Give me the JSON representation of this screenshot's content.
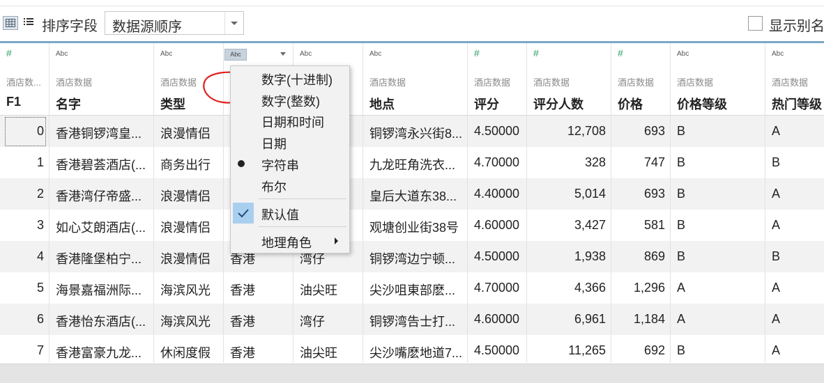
{
  "toolbar": {
    "sort_label": "排序字段",
    "sort_value": "数据源顺序",
    "show_alias_label": "显示别名"
  },
  "columns": [
    {
      "type": "#",
      "source": "酒店数...",
      "name": "F1"
    },
    {
      "type": "Abc",
      "source": "酒店数据",
      "name": "名字"
    },
    {
      "type": "Abc",
      "source": "酒店数据",
      "name": "类型"
    },
    {
      "type": "Abc",
      "source": "",
      "name": ""
    },
    {
      "type": "Abc",
      "source": "",
      "name": ""
    },
    {
      "type": "Abc",
      "source": "酒店数据",
      "name": "地点"
    },
    {
      "type": "#",
      "source": "酒店数据",
      "name": "评分"
    },
    {
      "type": "#",
      "source": "酒店数据",
      "name": "评分人数"
    },
    {
      "type": "#",
      "source": "酒店数据",
      "name": "价格"
    },
    {
      "type": "Abc",
      "source": "酒店数据",
      "name": "价格等级"
    },
    {
      "type": "Abc",
      "source": "酒店数据",
      "name": "热门等级"
    }
  ],
  "rows": [
    [
      "0",
      "香港铜锣湾皇...",
      "浪漫情侣",
      "",
      "",
      "铜锣湾永兴街8...",
      "4.50000",
      "12,708",
      "693",
      "B",
      "A"
    ],
    [
      "1",
      "香港碧荟酒店(...",
      "商务出行",
      "",
      "",
      "九龙旺角洗衣...",
      "4.70000",
      "328",
      "747",
      "B",
      "B"
    ],
    [
      "2",
      "香港湾仔帝盛...",
      "浪漫情侣",
      "",
      "",
      "皇后大道东38...",
      "4.40000",
      "5,014",
      "693",
      "B",
      "A"
    ],
    [
      "3",
      "如心艾朗酒店(...",
      "浪漫情侣",
      "",
      "",
      "观塘创业街38号",
      "4.60000",
      "3,427",
      "581",
      "B",
      "A"
    ],
    [
      "4",
      "香港隆堡柏宁...",
      "浪漫情侣",
      "香港",
      "湾仔",
      "铜锣湾边宁顿...",
      "4.50000",
      "1,938",
      "869",
      "B",
      "B"
    ],
    [
      "5",
      "海景嘉福洲际...",
      "海滨风光",
      "香港",
      "油尖旺",
      "尖沙咀東部麽...",
      "4.70000",
      "4,366",
      "1,296",
      "A",
      "A"
    ],
    [
      "6",
      "香港怡东酒店(...",
      "海滨风光",
      "香港",
      "湾仔",
      "铜锣湾告士打...",
      "4.60000",
      "6,961",
      "1,184",
      "A",
      "A"
    ],
    [
      "7",
      "香港富豪九龙...",
      "休闲度假",
      "香港",
      "油尖旺",
      "尖沙嘴麽地道7...",
      "4.50000",
      "11,265",
      "692",
      "B",
      "A"
    ]
  ],
  "context_menu": {
    "items": [
      {
        "label": "数字(十进制)",
        "mark": ""
      },
      {
        "label": "数字(整数)",
        "mark": ""
      },
      {
        "label": "日期和时间",
        "mark": ""
      },
      {
        "label": "日期",
        "mark": ""
      },
      {
        "label": "字符串",
        "mark": "dot"
      },
      {
        "label": "布尔",
        "mark": ""
      },
      {
        "label": "默认值",
        "mark": "check"
      },
      {
        "label": "地理角色",
        "mark": "",
        "submenu": true
      }
    ]
  },
  "colors": {
    "accent_line": "#7aa7c6",
    "selected_mark": "#a9cfee",
    "annotation": "#e02020"
  }
}
